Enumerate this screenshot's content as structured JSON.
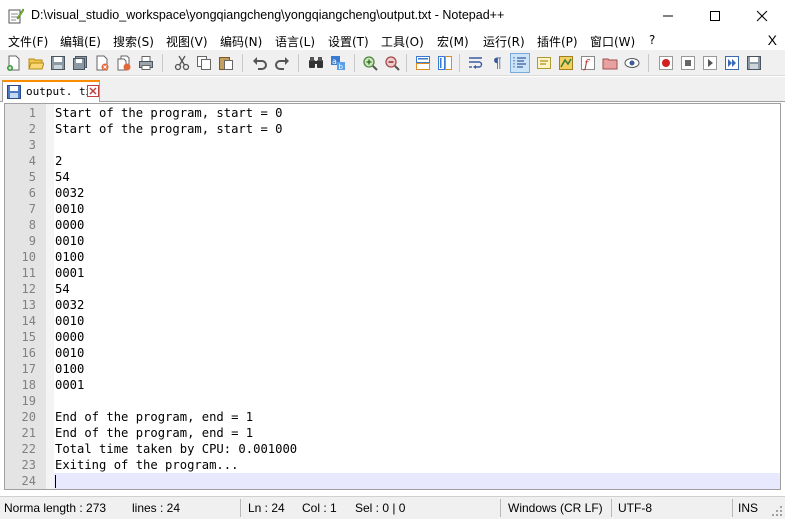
{
  "window": {
    "title": "D:\\visual_studio_workspace\\yongqiangcheng\\yongqiangcheng\\output.txt - Notepad++"
  },
  "menu": {
    "items": [
      "文件(F)",
      "编辑(E)",
      "搜索(S)",
      "视图(V)",
      "编码(N)",
      "语言(L)",
      "设置(T)",
      "工具(O)",
      "宏(M)",
      "运行(R)",
      "插件(P)",
      "窗口(W)",
      "?"
    ],
    "close": "X"
  },
  "toolbar": {
    "icons": [
      "new-file-icon",
      "open-file-icon",
      "save-icon",
      "save-all-icon",
      "close-icon",
      "close-all-icon",
      "print-icon",
      "cut-icon",
      "copy-icon",
      "paste-icon",
      "undo-icon",
      "redo-icon",
      "find-icon",
      "replace-icon",
      "zoom-in-icon",
      "zoom-out-icon",
      "sync-vertical-icon",
      "sync-horizontal-icon",
      "word-wrap-icon",
      "show-all-chars-icon",
      "indent-guide-icon",
      "user-language-icon",
      "document-map-icon",
      "function-list-icon",
      "folder-workspace-icon",
      "monitoring-icon",
      "record-macro-icon",
      "stop-macro-icon",
      "play-macro-icon",
      "run-macro-multiple-icon",
      "save-macro-icon"
    ]
  },
  "tab": {
    "label": "output. txt"
  },
  "editor": {
    "lines": [
      {
        "n": "1",
        "text": "Start of the program, start = 0"
      },
      {
        "n": "2",
        "text": "Start of the program, start = 0"
      },
      {
        "n": "3",
        "text": ""
      },
      {
        "n": "4",
        "text": "2"
      },
      {
        "n": "5",
        "text": "54"
      },
      {
        "n": "6",
        "text": "0032"
      },
      {
        "n": "7",
        "text": "0010"
      },
      {
        "n": "8",
        "text": "0000"
      },
      {
        "n": "9",
        "text": "0010"
      },
      {
        "n": "10",
        "text": "0100"
      },
      {
        "n": "11",
        "text": "0001"
      },
      {
        "n": "12",
        "text": "54"
      },
      {
        "n": "13",
        "text": "0032"
      },
      {
        "n": "14",
        "text": "0010"
      },
      {
        "n": "15",
        "text": "0000"
      },
      {
        "n": "16",
        "text": "0010"
      },
      {
        "n": "17",
        "text": "0100"
      },
      {
        "n": "18",
        "text": "0001"
      },
      {
        "n": "19",
        "text": ""
      },
      {
        "n": "20",
        "text": "End of the program, end = 1"
      },
      {
        "n": "21",
        "text": "End of the program, end = 1"
      },
      {
        "n": "22",
        "text": "Total time taken by CPU: 0.001000"
      },
      {
        "n": "23",
        "text": "Exiting of the program..."
      },
      {
        "n": "24",
        "text": ""
      }
    ],
    "current_line": 24
  },
  "status": {
    "length": "Norma length : 273",
    "lines": "lines : 24",
    "ln": "Ln : 24",
    "col": "Col : 1",
    "sel": "Sel : 0 | 0",
    "eol": "Windows (CR LF)",
    "encoding": "UTF-8",
    "mode": "INS"
  },
  "colors": {
    "tab_accent": "#fa8c00",
    "current_line": "#e8e8ff",
    "gutter": "#e4e4e4",
    "line_number": "#808080"
  }
}
